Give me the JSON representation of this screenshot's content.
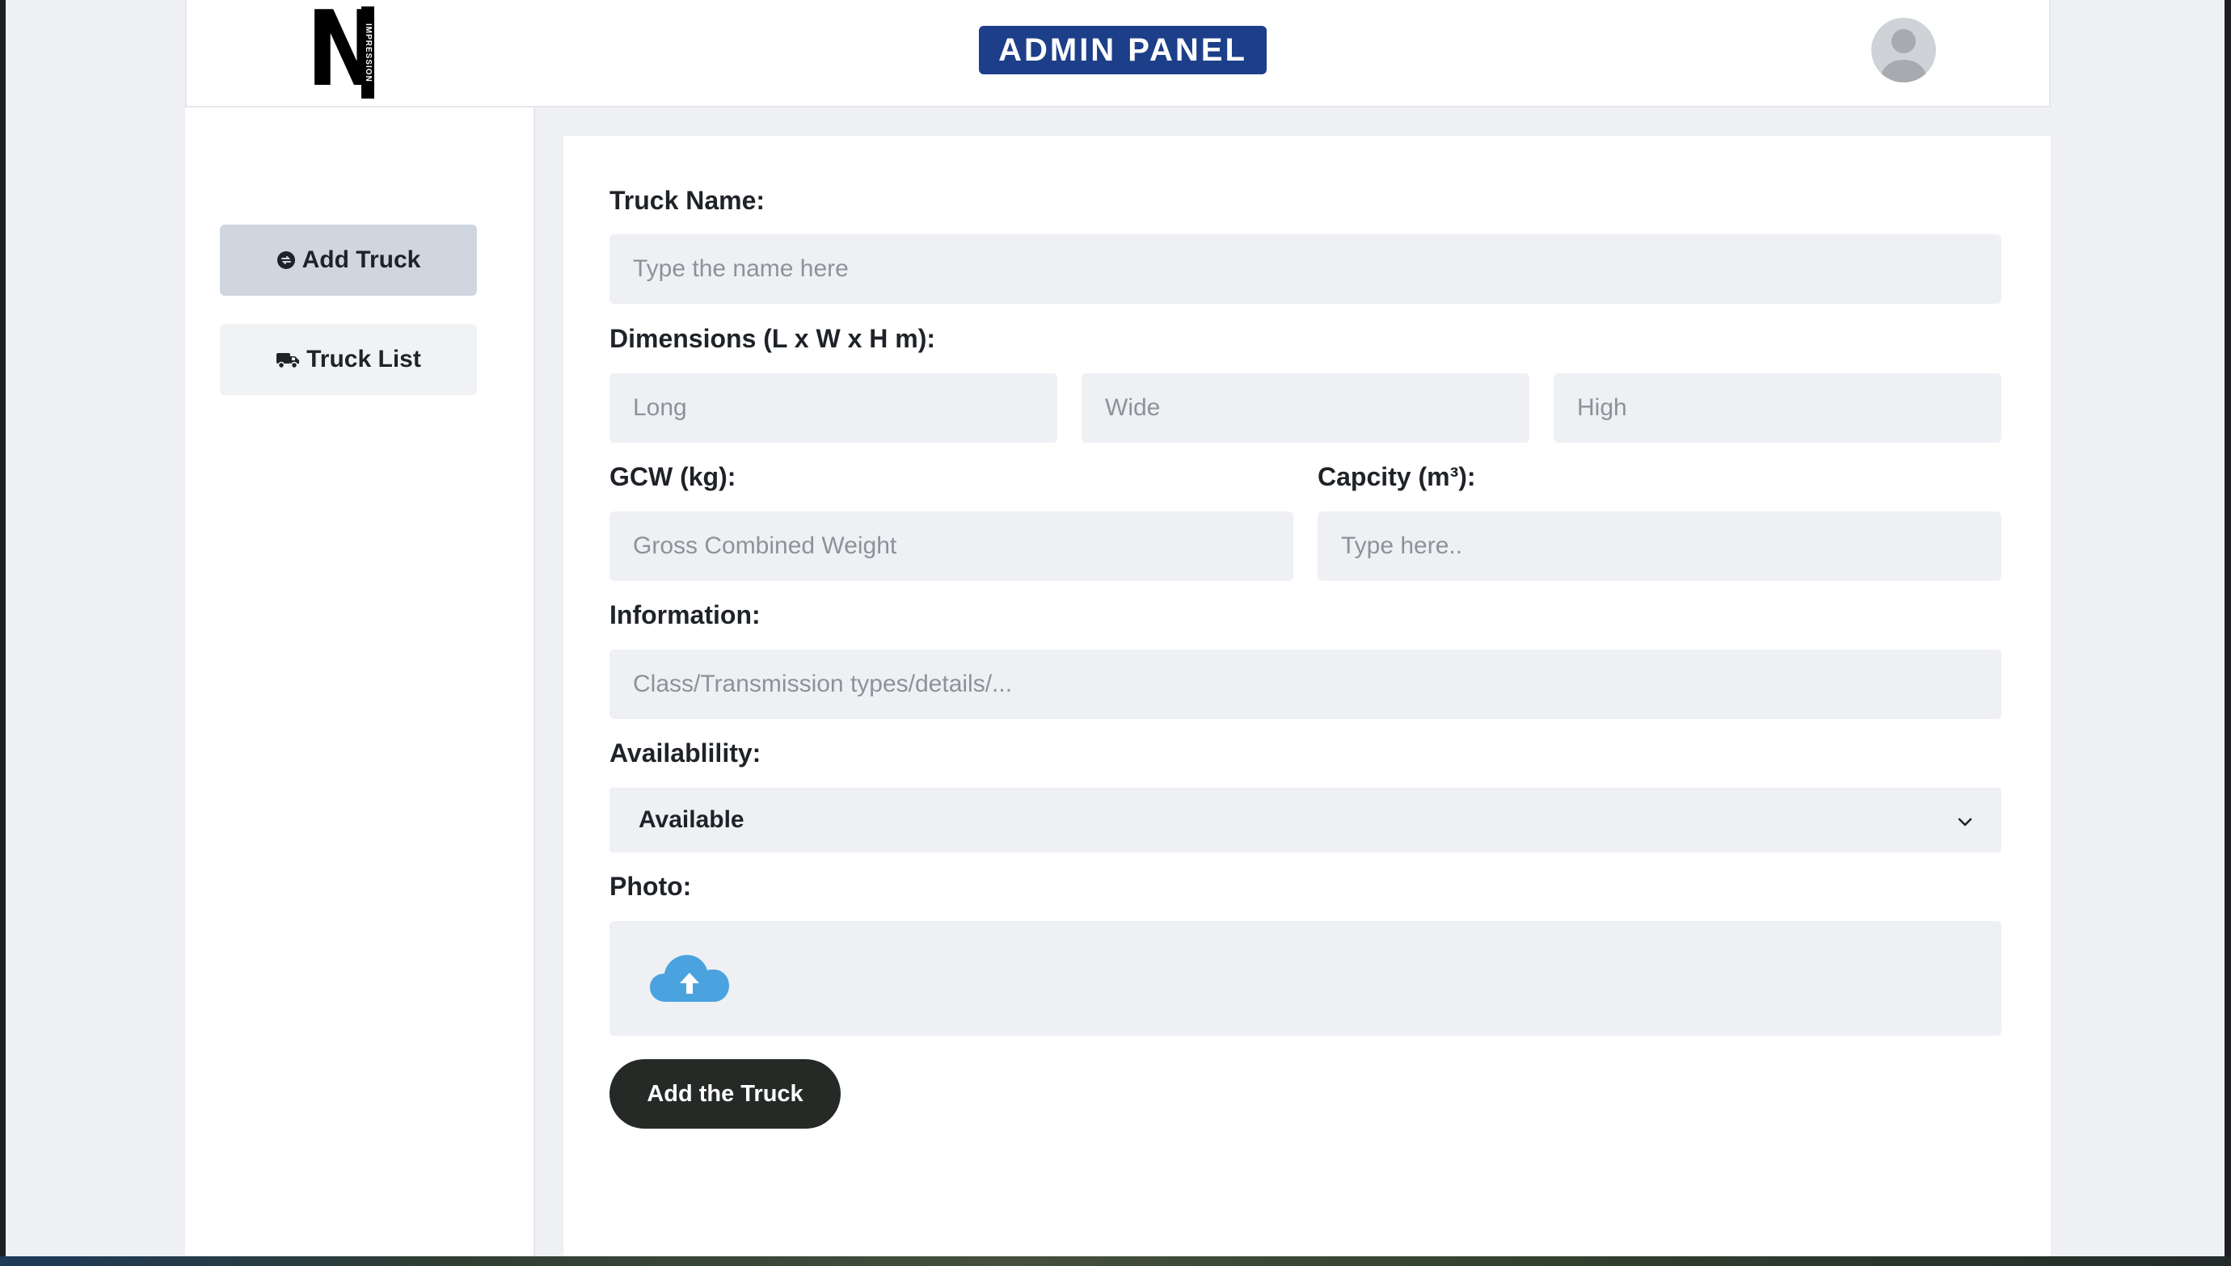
{
  "header": {
    "logo_letter": "N",
    "logo_vertical_text": "IMPRESSION",
    "title": "ADMIN PANEL"
  },
  "sidebar": {
    "items": [
      {
        "label": "Add Truck",
        "icon": "circle-plus-icon",
        "active": true
      },
      {
        "label": "Truck List",
        "icon": "truck-icon",
        "active": false
      }
    ]
  },
  "form": {
    "truck_name": {
      "label": "Truck Name:",
      "placeholder": "Type the name here",
      "value": ""
    },
    "dimensions": {
      "label": "Dimensions (L x W x H m):",
      "long_placeholder": "Long",
      "wide_placeholder": "Wide",
      "high_placeholder": "High"
    },
    "gcw": {
      "label": "GCW (kg):",
      "placeholder": "Gross Combined Weight"
    },
    "capacity": {
      "label": "Capcity (m³):",
      "placeholder": "Type here.."
    },
    "information": {
      "label": "Information:",
      "placeholder": "Class/Transmission types/details/..."
    },
    "availability": {
      "label": "Availablility:",
      "selected": "Available",
      "icon": "chevron-down-icon"
    },
    "photo": {
      "label": "Photo:",
      "icon": "cloud-upload-icon"
    },
    "submit_label": "Add the Truck"
  },
  "colors": {
    "badge": "#1d3f8a",
    "active_nav": "#cfd6e0",
    "input_bg": "#eef0f4",
    "submit_bg": "#262a27",
    "cloud": "#4aa3df"
  }
}
